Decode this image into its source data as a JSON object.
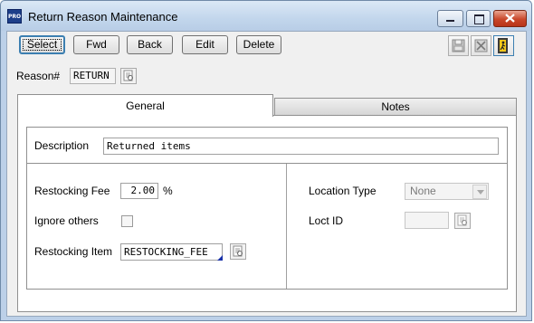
{
  "window": {
    "title": "Return Reason Maintenance",
    "app_badge": "PRO"
  },
  "toolbar": {
    "select": "Select",
    "fwd": "Fwd",
    "back": "Back",
    "edit": "Edit",
    "delete": "Delete"
  },
  "reason": {
    "label": "Reason#",
    "value": "RETURN"
  },
  "tabs": [
    {
      "label": "General",
      "active": true
    },
    {
      "label": "Notes",
      "active": false
    }
  ],
  "general": {
    "description_label": "Description",
    "description_value": "Returned items",
    "restocking_fee_label": "Restocking Fee",
    "restocking_fee_value": "2.00",
    "restocking_fee_unit": "%",
    "ignore_others_label": "Ignore others",
    "ignore_others_checked": false,
    "restocking_item_label": "Restocking Item",
    "restocking_item_value": "RESTOCKING_FEE",
    "location_type_label": "Location Type",
    "location_type_value": "None",
    "loct_id_label": "Loct ID",
    "loct_id_value": ""
  },
  "icons": {
    "save": "save-icon",
    "cancel": "cancel-icon",
    "exit": "exit-door-icon",
    "lookup": "lookup-icon"
  }
}
